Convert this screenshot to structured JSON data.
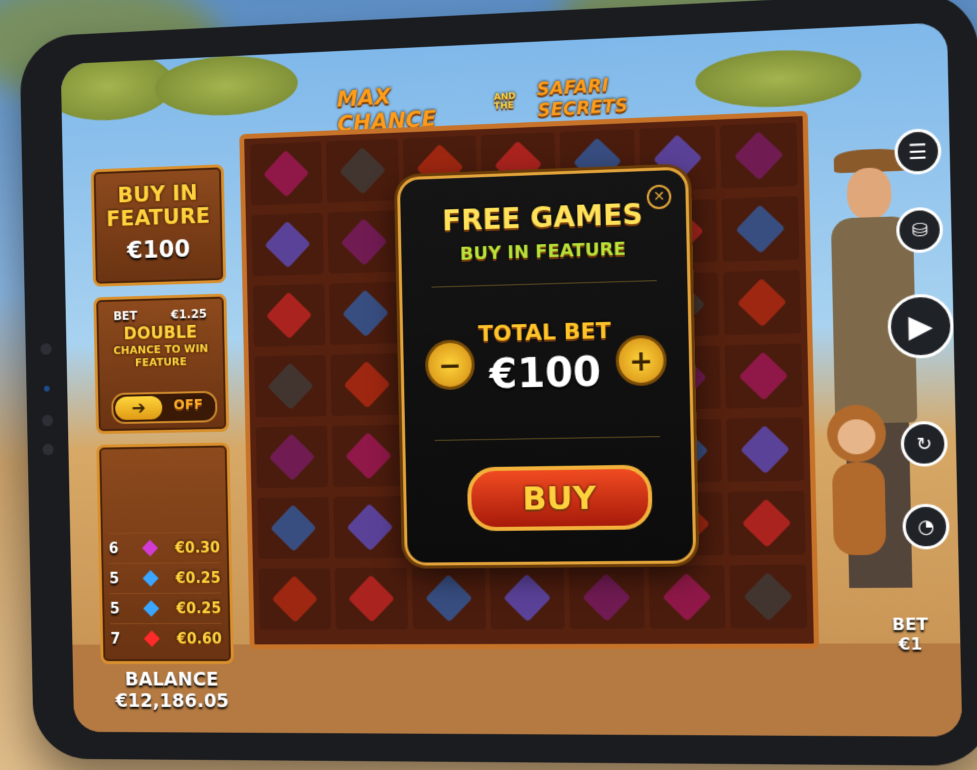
{
  "game": {
    "title_line1": "MAX CHANCE",
    "title_and_the": "AND THE",
    "title_line2": "SAFARI SECRETS"
  },
  "buy_feature": {
    "label": "BUY IN FEATURE",
    "price": "€100"
  },
  "double_chance": {
    "bet_label": "BET",
    "bet_value": "€1.25",
    "title": "DOUBLE",
    "subtitle": "CHANCE TO WIN FEATURE",
    "toggle_state": "OFF"
  },
  "paytable": [
    {
      "count": "6",
      "symbol": "purple-gem",
      "color": "#d33bd6",
      "value": "€0.30"
    },
    {
      "count": "5",
      "symbol": "blue-diamond",
      "color": "#3aa6ff",
      "value": "€0.25"
    },
    {
      "count": "5",
      "symbol": "blue-diamond",
      "color": "#3aa6ff",
      "value": "€0.25"
    },
    {
      "count": "7",
      "symbol": "red-gem",
      "color": "#ff2a2a",
      "value": "€0.60"
    }
  ],
  "balance": {
    "label": "BALANCE",
    "value": "€12,186.05"
  },
  "bet": {
    "label": "BET",
    "value": "€1"
  },
  "modal": {
    "title": "FREE GAMES",
    "subtitle": "BUY IN FEATURE",
    "total_bet_label": "TOTAL BET",
    "total_bet_value": "€100",
    "buy_label": "BUY",
    "minus": "−",
    "plus": "+"
  },
  "side_buttons": [
    "menu-icon",
    "coins-icon",
    "play-icon",
    "autoplay-icon",
    "turbo-icon"
  ],
  "colors": {
    "gold": "#ffd23d",
    "frame": "#c7742a",
    "buy_red": "#d8320f"
  }
}
